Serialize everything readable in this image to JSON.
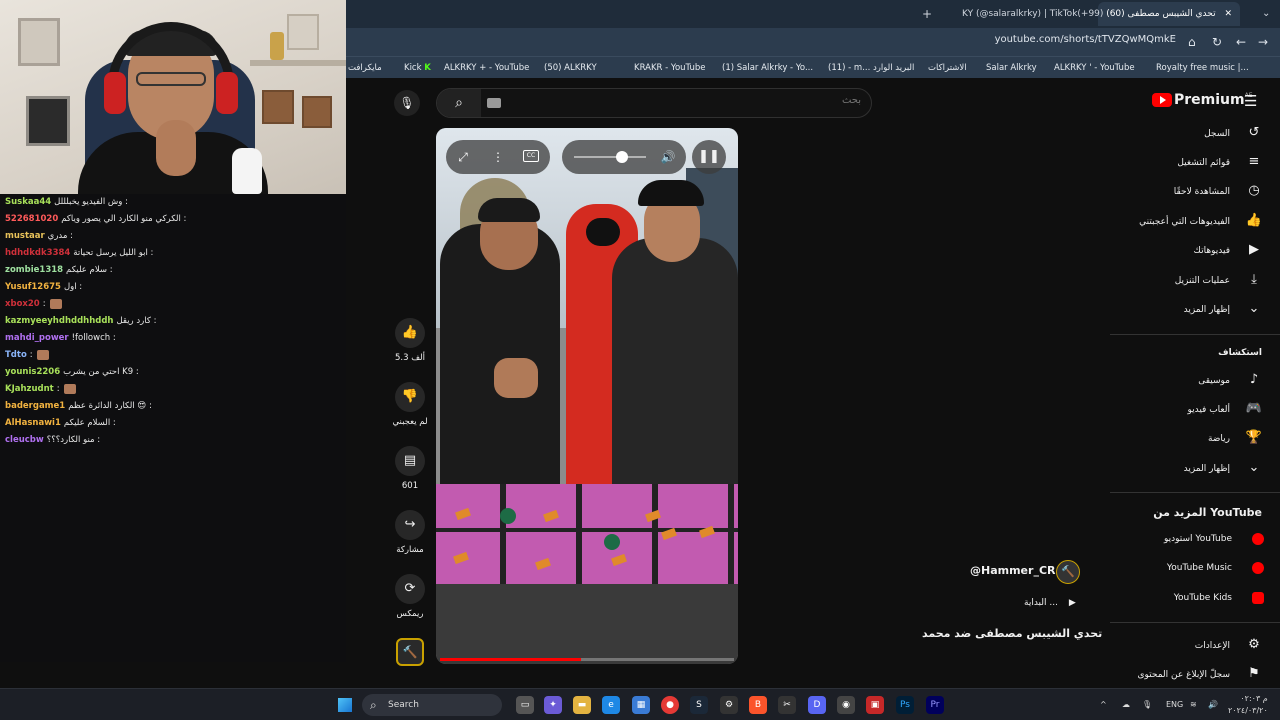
{
  "browser": {
    "tabs": [
      {
        "label": "(60) تحدي الشيبس مصطفى",
        "active": true
      },
      {
        "label": "KY (@salaralkrky) | TikTok(+99)",
        "active": false
      }
    ],
    "new_tab": "+",
    "url": "youtube.com/shorts/tTVZQwMQmkE",
    "bookmarks": [
      "مايكرافت",
      "Kick",
      "ALKRKY + - YouTube",
      "(50) ALKRKY",
      "KRAKR - YouTube",
      "(1) Salar Alkrky - Yo...",
      "(11) - m... البريد الوارد",
      "الاشتراكات",
      "Salar Alkrky",
      "ALKRKY ' - YouTube",
      "Royalty free music |..."
    ]
  },
  "chat": {
    "messages": [
      {
        "user": "Suskaa44",
        "color": "#a8e05a",
        "text": "وش الفيديو يخبلللل :"
      },
      {
        "user": "522681020",
        "color": "#ff5a5a",
        "text": "الكركي منو الكارد الي يصور وياكم :"
      },
      {
        "user": "mustaar",
        "color": "#e8c25a",
        "text": "مدري :"
      },
      {
        "user": "hdhdkdk3384",
        "color": "#d0303a",
        "text": "ابو الليل يرسل تحياتة :"
      },
      {
        "user": "zombie1318",
        "color": "#9fe0a0",
        "text": "سلام عليكم :"
      },
      {
        "user": "Yusuf12675",
        "color": "#f2b340",
        "text": "اول :"
      },
      {
        "user": "xbox20",
        "color": "#d0303a",
        "text": ":",
        "emote": true
      },
      {
        "user": "kazmyeeyhdhddhhddh",
        "color": "#a8e05a",
        "text": "كارد ريقل :"
      },
      {
        "user": "mahdi_power",
        "color": "#b070f0",
        "text": "!followch :"
      },
      {
        "user": "Tdto",
        "color": "#8ab4f8",
        "text": ":",
        "emote": true
      },
      {
        "user": "younis2206",
        "color": "#a8e05a",
        "text": "احتي من يشرب K9 :"
      },
      {
        "user": "KJahzudnt",
        "color": "#a8e05a",
        "text": ":",
        "emote": true
      },
      {
        "user": "badergame1",
        "color": "#f2b340",
        "text": "الكارد الدائرة عظم 😍 :"
      },
      {
        "user": "AlHasnawi1",
        "color": "#f2b340",
        "text": "السلام عليكم :"
      },
      {
        "user": "cleucbw",
        "color": "#b070f0",
        "text": "منو الكارد؟؟؟ :"
      }
    ]
  },
  "youtube": {
    "search_placeholder": "بحث",
    "logo": "Premium",
    "logo_region": "AE",
    "menu_icon": "hamburger-icon",
    "sidebar": {
      "you_items": [
        {
          "label": "السجل",
          "icon": "history-icon"
        },
        {
          "label": "قوائم التشغيل",
          "icon": "playlists-icon"
        },
        {
          "label": "المشاهدة لاحقًا",
          "icon": "watch-later-icon"
        },
        {
          "label": "الفيديوهات التي أعجبتني",
          "icon": "like-icon"
        },
        {
          "label": "فيديوهاتك",
          "icon": "your-videos-icon"
        },
        {
          "label": "عمليات التنزيل",
          "icon": "download-icon"
        },
        {
          "label": "إظهار المزيد",
          "icon": "chevron-down-icon"
        }
      ],
      "explore_title": "استكشاف",
      "explore_items": [
        {
          "label": "موسيقى",
          "icon": "music-icon"
        },
        {
          "label": "ألعاب فيديو",
          "icon": "gaming-icon"
        },
        {
          "label": "رياضة",
          "icon": "trophy-icon"
        },
        {
          "label": "إظهار المزيد",
          "icon": "chevron-down-icon"
        }
      ],
      "more_title": "المزيد من YouTube",
      "more_items": [
        {
          "label": "استوديو YouTube"
        },
        {
          "label": "YouTube Music"
        },
        {
          "label": "YouTube Kids"
        }
      ],
      "settings_items": [
        {
          "label": "الإعدادات",
          "icon": "gear-icon"
        },
        {
          "label": "سجلّ الإبلاغ عن المحتوى",
          "icon": "flag-icon"
        }
      ]
    },
    "actions": {
      "likes": "5.3 ألف",
      "dislike": "لم يعجبني",
      "comments": "601",
      "share": "مشاركة",
      "remix": "ريمكس"
    },
    "video": {
      "progress": 0.48,
      "cc_label": "CC"
    },
    "info": {
      "handle": "@Hammer_CR",
      "beginning": "البداية ...",
      "title": "تحدي الشيبس مصطفى ضد محمد"
    }
  },
  "taskbar": {
    "search": "Search",
    "lang": "ENG",
    "time": "م ٠٢:٠٣",
    "date": "٢٠٢٤/٠٣/٢٠"
  }
}
